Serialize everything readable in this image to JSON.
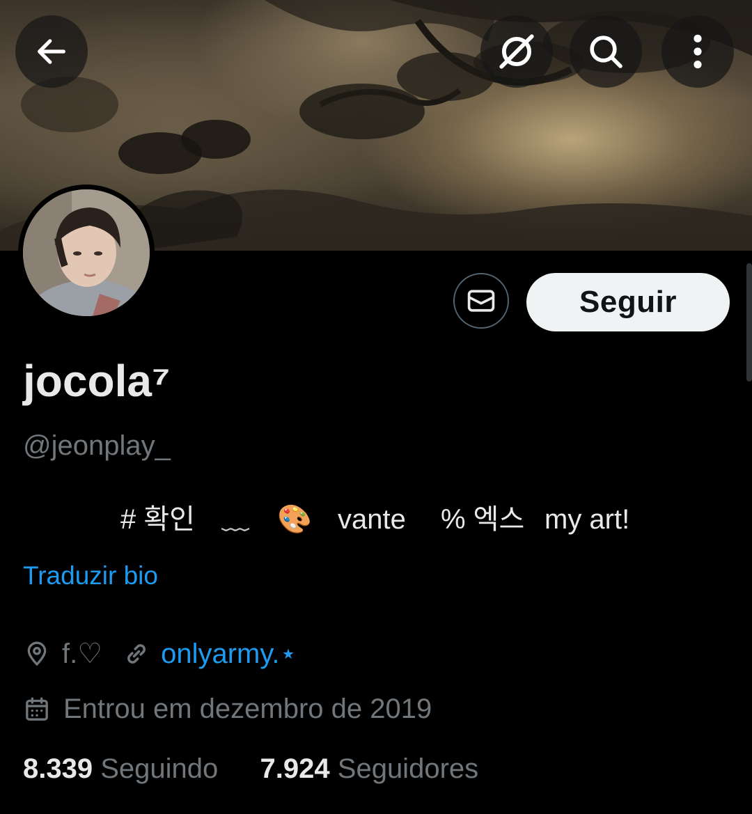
{
  "top_bar": {
    "back_icon": "arrow-left-icon",
    "grok_icon": "grok-icon",
    "search_icon": "search-icon",
    "more_icon": "more-vertical-icon"
  },
  "profile": {
    "display_name": "jocola⁷",
    "handle": "@jeonplay_",
    "follow_label": "Seguir",
    "message_icon": "envelope-icon"
  },
  "bio": {
    "parts": [
      "# 확인",
      "﹏",
      "🎨",
      "vante",
      "% 엑스",
      "my art!"
    ],
    "translate_label": "Traduzir bio"
  },
  "meta": {
    "location": "f.♡",
    "link": "onlyarmy.⋆",
    "joined": "Entrou em dezembro de 2019"
  },
  "stats": {
    "following_count": "8.339",
    "following_label": "Seguindo",
    "followers_count": "7.924",
    "followers_label": "Seguidores"
  },
  "colors": {
    "accent": "#1d9bf0",
    "secondary_text": "#71767b",
    "primary_text": "#e7e9ea",
    "background": "#000000"
  }
}
